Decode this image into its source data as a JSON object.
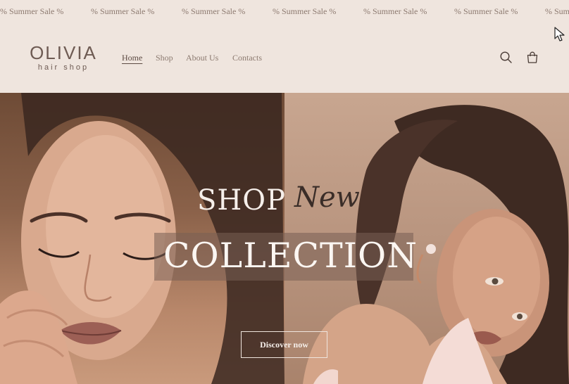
{
  "announcement": {
    "items": [
      "% Summer Sale %",
      "% Summer Sale %",
      "% Summer Sale %",
      "% Summer Sale %",
      "% Summer Sale %",
      "% Summer Sale %",
      "% Summer Sale %"
    ]
  },
  "header": {
    "logo_main": "OLIVIA",
    "logo_sub": "hair shop",
    "nav": [
      {
        "label": "Home",
        "active": true
      },
      {
        "label": "Shop",
        "active": false
      },
      {
        "label": "About Us",
        "active": false
      },
      {
        "label": "Contacts",
        "active": false
      }
    ],
    "icons": {
      "search": "search-icon",
      "cart": "cart-icon"
    }
  },
  "hero": {
    "headline_shop": "SHOP",
    "headline_new": "New",
    "headline_collection": "COLLECTION",
    "cta_label": "Discover now"
  },
  "colors": {
    "background": "#efe5de",
    "text": "#6f5d55",
    "hero_text": "#f6efea"
  }
}
